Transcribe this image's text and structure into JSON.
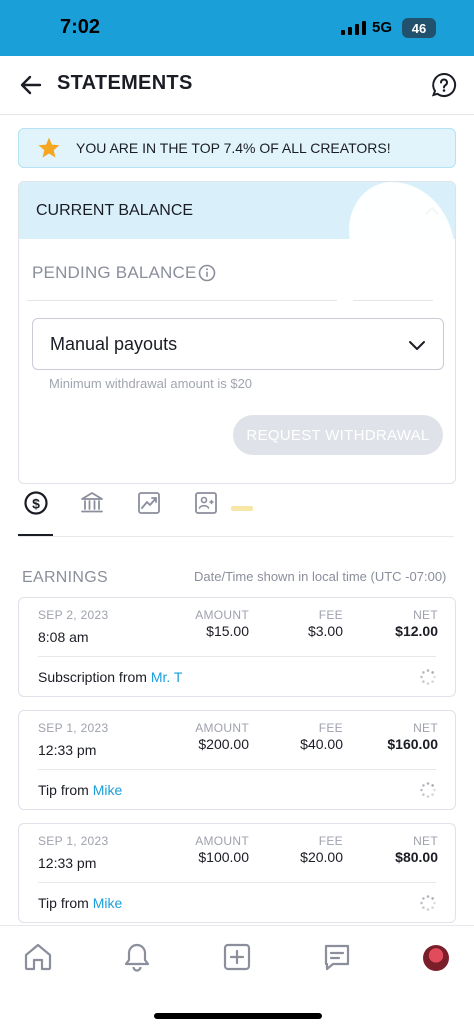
{
  "status_bar": {
    "time": "7:02",
    "network": "5G",
    "battery": "46"
  },
  "header": {
    "title": "STATEMENTS"
  },
  "banner": {
    "text": "YOU ARE IN THE TOP 7.4% OF ALL CREATORS!"
  },
  "balance": {
    "current_label": "CURRENT BALANCE",
    "pending_label": "PENDING BALANCE",
    "payout_select_value": "Manual payouts",
    "min_withdrawal_hint": "Minimum withdrawal amount is $20",
    "withdraw_button": "REQUEST WITHDRAWAL"
  },
  "earnings": {
    "heading": "EARNINGS",
    "timezone_note": "Date/Time shown in local time (UTC -07:00)",
    "column_labels": {
      "amount": "AMOUNT",
      "fee": "FEE",
      "net": "NET"
    },
    "items": [
      {
        "date": "SEP 2, 2023",
        "time": "8:08 am",
        "amount": "$15.00",
        "fee": "$3.00",
        "net": "$12.00",
        "desc_prefix": "Subscription from ",
        "user": "Mr. T"
      },
      {
        "date": "SEP 1, 2023",
        "time": "12:33 pm",
        "amount": "$200.00",
        "fee": "$40.00",
        "net": "$160.00",
        "desc_prefix": "Tip from ",
        "user": "Mike"
      },
      {
        "date": "SEP 1, 2023",
        "time": "12:33 pm",
        "amount": "$100.00",
        "fee": "$20.00",
        "net": "$80.00",
        "desc_prefix": "Tip from ",
        "user": "Mike"
      }
    ]
  },
  "tabs": [
    "earnings-tab-icon",
    "bank-tab-icon",
    "chart-tab-icon",
    "statement-tab-icon"
  ],
  "bottom_nav": [
    "home-icon",
    "bell-icon",
    "add-icon",
    "chat-icon",
    "avatar"
  ],
  "colors": {
    "accent": "#1a9fd9",
    "status_bar": "#1a9fd9",
    "banner_bg": "#e2f4fb",
    "star": "#f5a623"
  }
}
